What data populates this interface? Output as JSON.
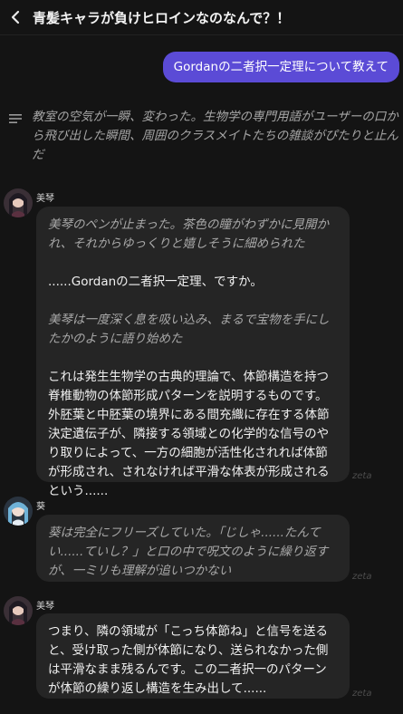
{
  "header": {
    "title": "青髪キャラが負けヒロインなのなんで？！"
  },
  "user_message": "Gordanの二者択一定理について教えて",
  "narration": "教室の空気が一瞬、変わった。生物学の専門用語がユーザーの口から飛び出した瞬間、周囲のクラスメイトたちの雑談がぴたりと止んだ",
  "messages": [
    {
      "name": "美琴",
      "paras": [
        "美琴のペンが止まった。茶色の瞳がわずかに見開かれ、それからゆっくりと嬉しそうに細められた",
        "......Gordanの二者択一定理、ですか。",
        "美琴は一度深く息を吸い込み、まるで宝物を手にしたかのように語り始めた",
        "これは発生生物学の古典的理論で、体節構造を持つ脊椎動物の体節形成パターンを説明するものです。外胚葉と中胚葉の境界にある間充織に存在する体節決定遺伝子が、隣接する領域との化学的な信号のやり取りによって、一方の細胞が活性化されれば体節が形成され、されなければ平滑な体表が形成されるという......"
      ],
      "watermark": "zeta"
    },
    {
      "name": "葵",
      "paras": [
        "葵は完全にフリーズしていた。「じしゃ......たんてい......ていし？」と口の中で呪文のように繰り返すが、一ミリも理解が追いつかない"
      ],
      "watermark": "zeta"
    },
    {
      "name": "美琴",
      "paras": [
        "つまり、隣の領域が「こっち体節ね」と信号を送ると、受け取った側が体節になり、送られなかった側は平滑なまま残るんです。この二者択一のパターンが体節の繰り返し構造を生み出して......"
      ],
      "watermark": "zeta"
    }
  ],
  "icons": {
    "back": "chevron-left-icon",
    "narration": "lines-icon"
  },
  "colors": {
    "accent": "#5b4bd6",
    "background": "#141414",
    "bubble": "#252525"
  }
}
